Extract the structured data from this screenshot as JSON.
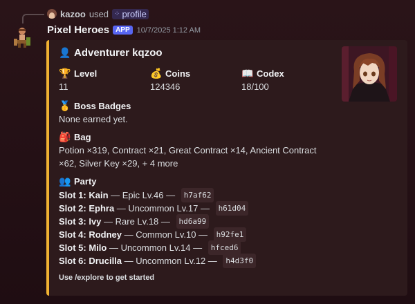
{
  "reply": {
    "username": "kazoo",
    "used": "used",
    "command": "profile"
  },
  "message": {
    "bot_name": "Pixel Heroes",
    "app_badge": "APP",
    "timestamp": "10/7/2025 1:12 AM"
  },
  "embed": {
    "accent_color": "#f0b132",
    "title_icon": "bust-in-silhouette-icon",
    "title": "Adventurer kqzoo",
    "stats": [
      {
        "icon": "trophy-icon",
        "name": "Level",
        "value": "11"
      },
      {
        "icon": "money-bag-icon",
        "name": "Coins",
        "value": "124346"
      },
      {
        "icon": "open-book-icon",
        "name": "Codex",
        "value": "18/100"
      }
    ],
    "badges": {
      "icon": "medal-icon",
      "name": "Boss Badges",
      "value": "None earned yet."
    },
    "bag": {
      "icon": "backpack-icon",
      "name": "Bag",
      "line1": "Potion ×319, Contract ×21, Great Contract ×14, Ancient Contract",
      "line2": "×62, Silver Key ×29, + 4 more"
    },
    "party": {
      "icon": "busts-icon",
      "name": "Party",
      "slots": [
        {
          "label": "Slot 1: Kain",
          "detail": " — Epic Lv.46 — ",
          "code": "h7af62"
        },
        {
          "label": "Slot 2: Ephra",
          "detail": " — Uncommon Lv.17 — ",
          "code": "h61d04"
        },
        {
          "label": "Slot 3: Ivy",
          "detail": " — Rare Lv.18 — ",
          "code": "hd6a99"
        },
        {
          "label": "Slot 4: Rodney",
          "detail": " — Common Lv.10 — ",
          "code": "h92fe1"
        },
        {
          "label": "Slot 5: Milo",
          "detail": " — Uncommon Lv.14 — ",
          "code": "hfced6"
        },
        {
          "label": "Slot 6: Drucilla",
          "detail": " — Uncommon Lv.12 — ",
          "code": "h4d3f0"
        }
      ]
    },
    "footer": "Use /explore to get started"
  }
}
